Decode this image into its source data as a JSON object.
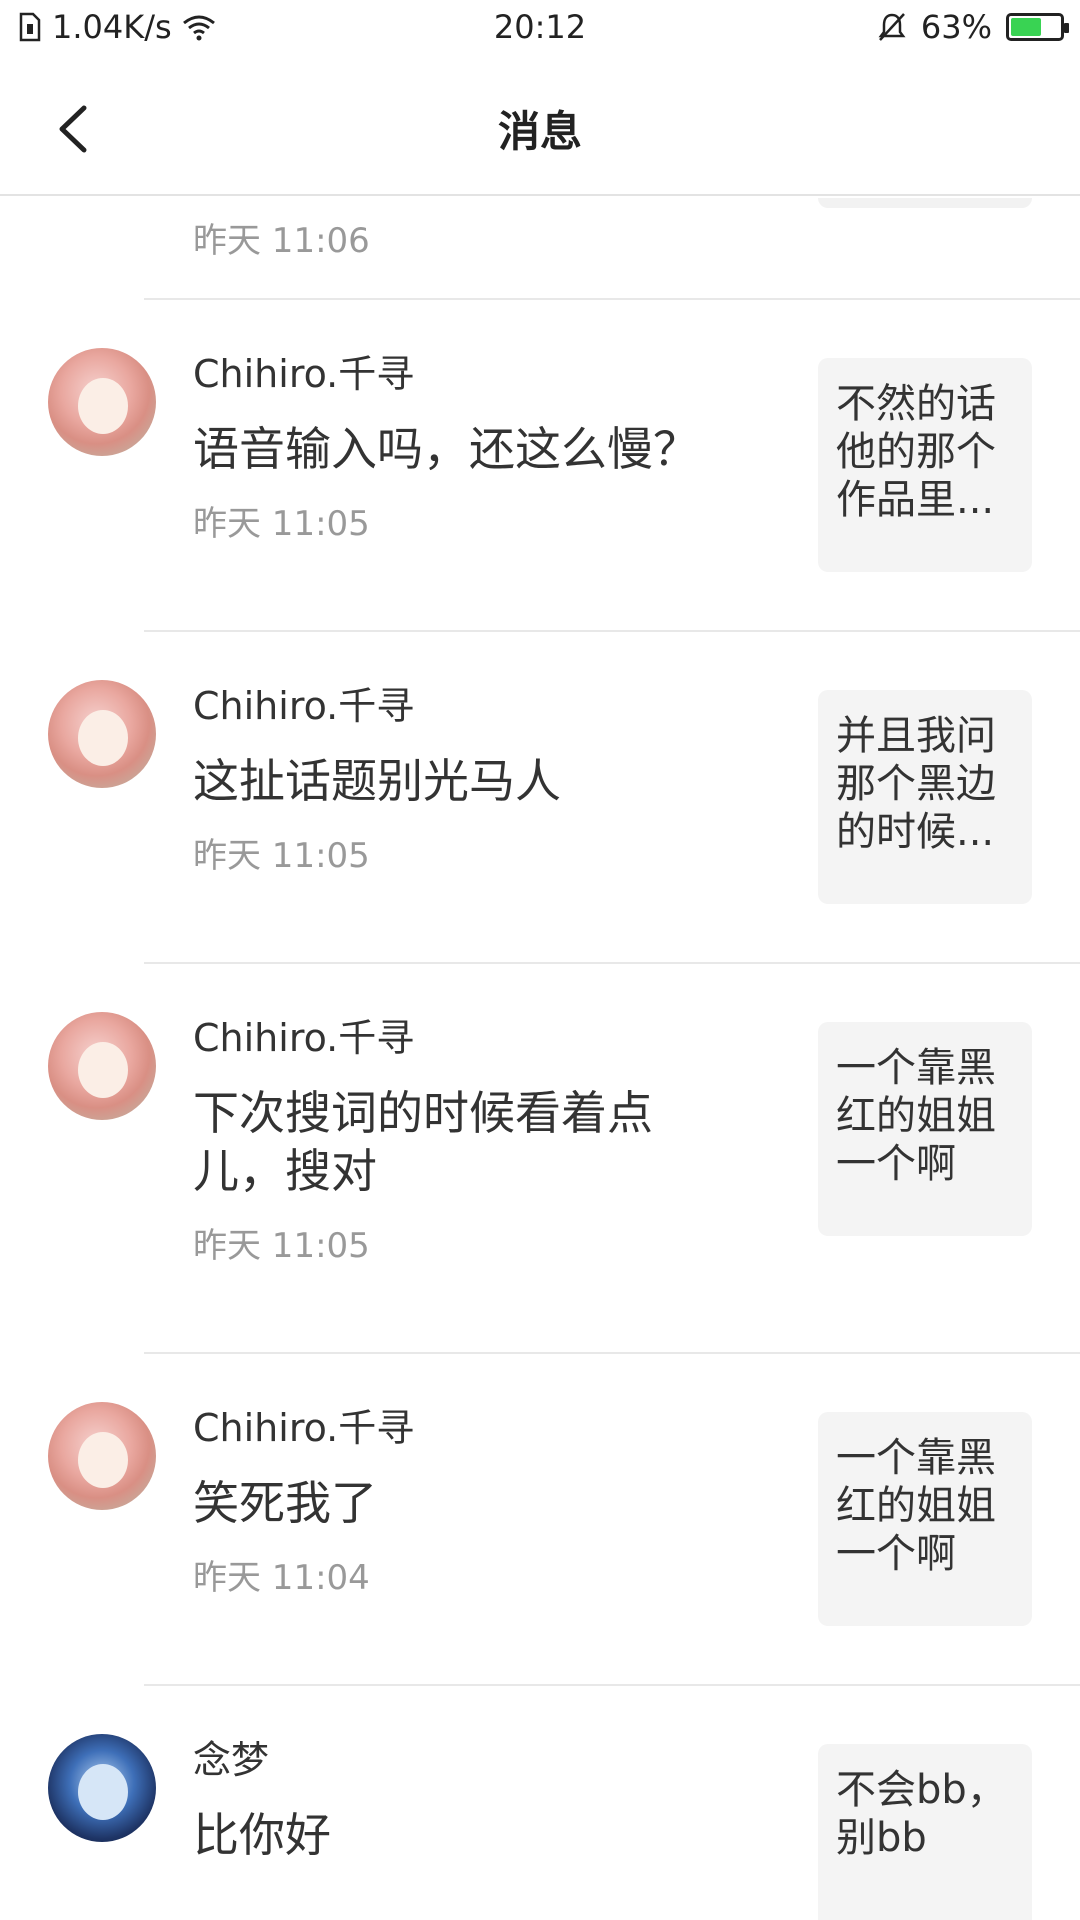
{
  "status_bar": {
    "speed": "1.04K/s",
    "time": "20:12",
    "battery": "63%",
    "battery_level": 0.63
  },
  "header": {
    "title": "消息"
  },
  "partial_item": {
    "time": "昨天 11:06"
  },
  "messages": [
    {
      "name": "Chihiro.千寻",
      "text": "语音输入吗，还这么慢？",
      "time": "昨天 11:05",
      "quote": "不然的话他的那个作品里...",
      "avatar": "avatar-anime-girl-pink"
    },
    {
      "name": "Chihiro.千寻",
      "text": "这扯话题别光马人",
      "time": "昨天 11:05",
      "quote": "并且我问那个黑边的时候...",
      "avatar": "avatar-anime-girl-pink"
    },
    {
      "name": "Chihiro.千寻",
      "text": "下次搜词的时候看着点儿，搜对",
      "time": "昨天 11:05",
      "quote": "一个靠黑红的姐姐一个啊",
      "avatar": "avatar-anime-girl-pink"
    },
    {
      "name": "Chihiro.千寻",
      "text": "笑死我了",
      "time": "昨天 11:04",
      "quote": "一个靠黑红的姐姐一个啊",
      "avatar": "avatar-anime-girl-pink"
    },
    {
      "name": "念梦",
      "text": "比你好",
      "time": "",
      "quote": "不会bb，别bb",
      "avatar": "avatar-anime-girl-blue"
    }
  ]
}
